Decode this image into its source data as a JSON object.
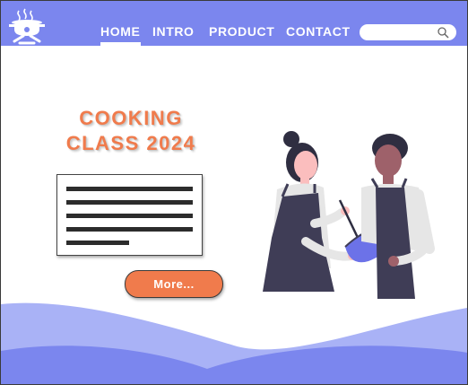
{
  "nav": {
    "items": [
      {
        "label": "HOME",
        "active": true
      },
      {
        "label": "INTRO",
        "active": false
      },
      {
        "label": "PRODUCT",
        "active": false
      },
      {
        "label": "CONTACT",
        "active": false
      }
    ]
  },
  "search": {
    "placeholder": "",
    "icon": "search-icon"
  },
  "logo": {
    "icon": "cooking-pot-icon"
  },
  "hero": {
    "title_line1": "COOKING",
    "title_line2": "CLASS 2024",
    "more_label": "More..."
  },
  "colors": {
    "header": "#7b86ee",
    "accent": "#f07b4c",
    "wave_light": "#a9b2f6",
    "wave_dark": "#7b86ee"
  },
  "illustration": {
    "icon": "chefs-cooking-illustration"
  }
}
